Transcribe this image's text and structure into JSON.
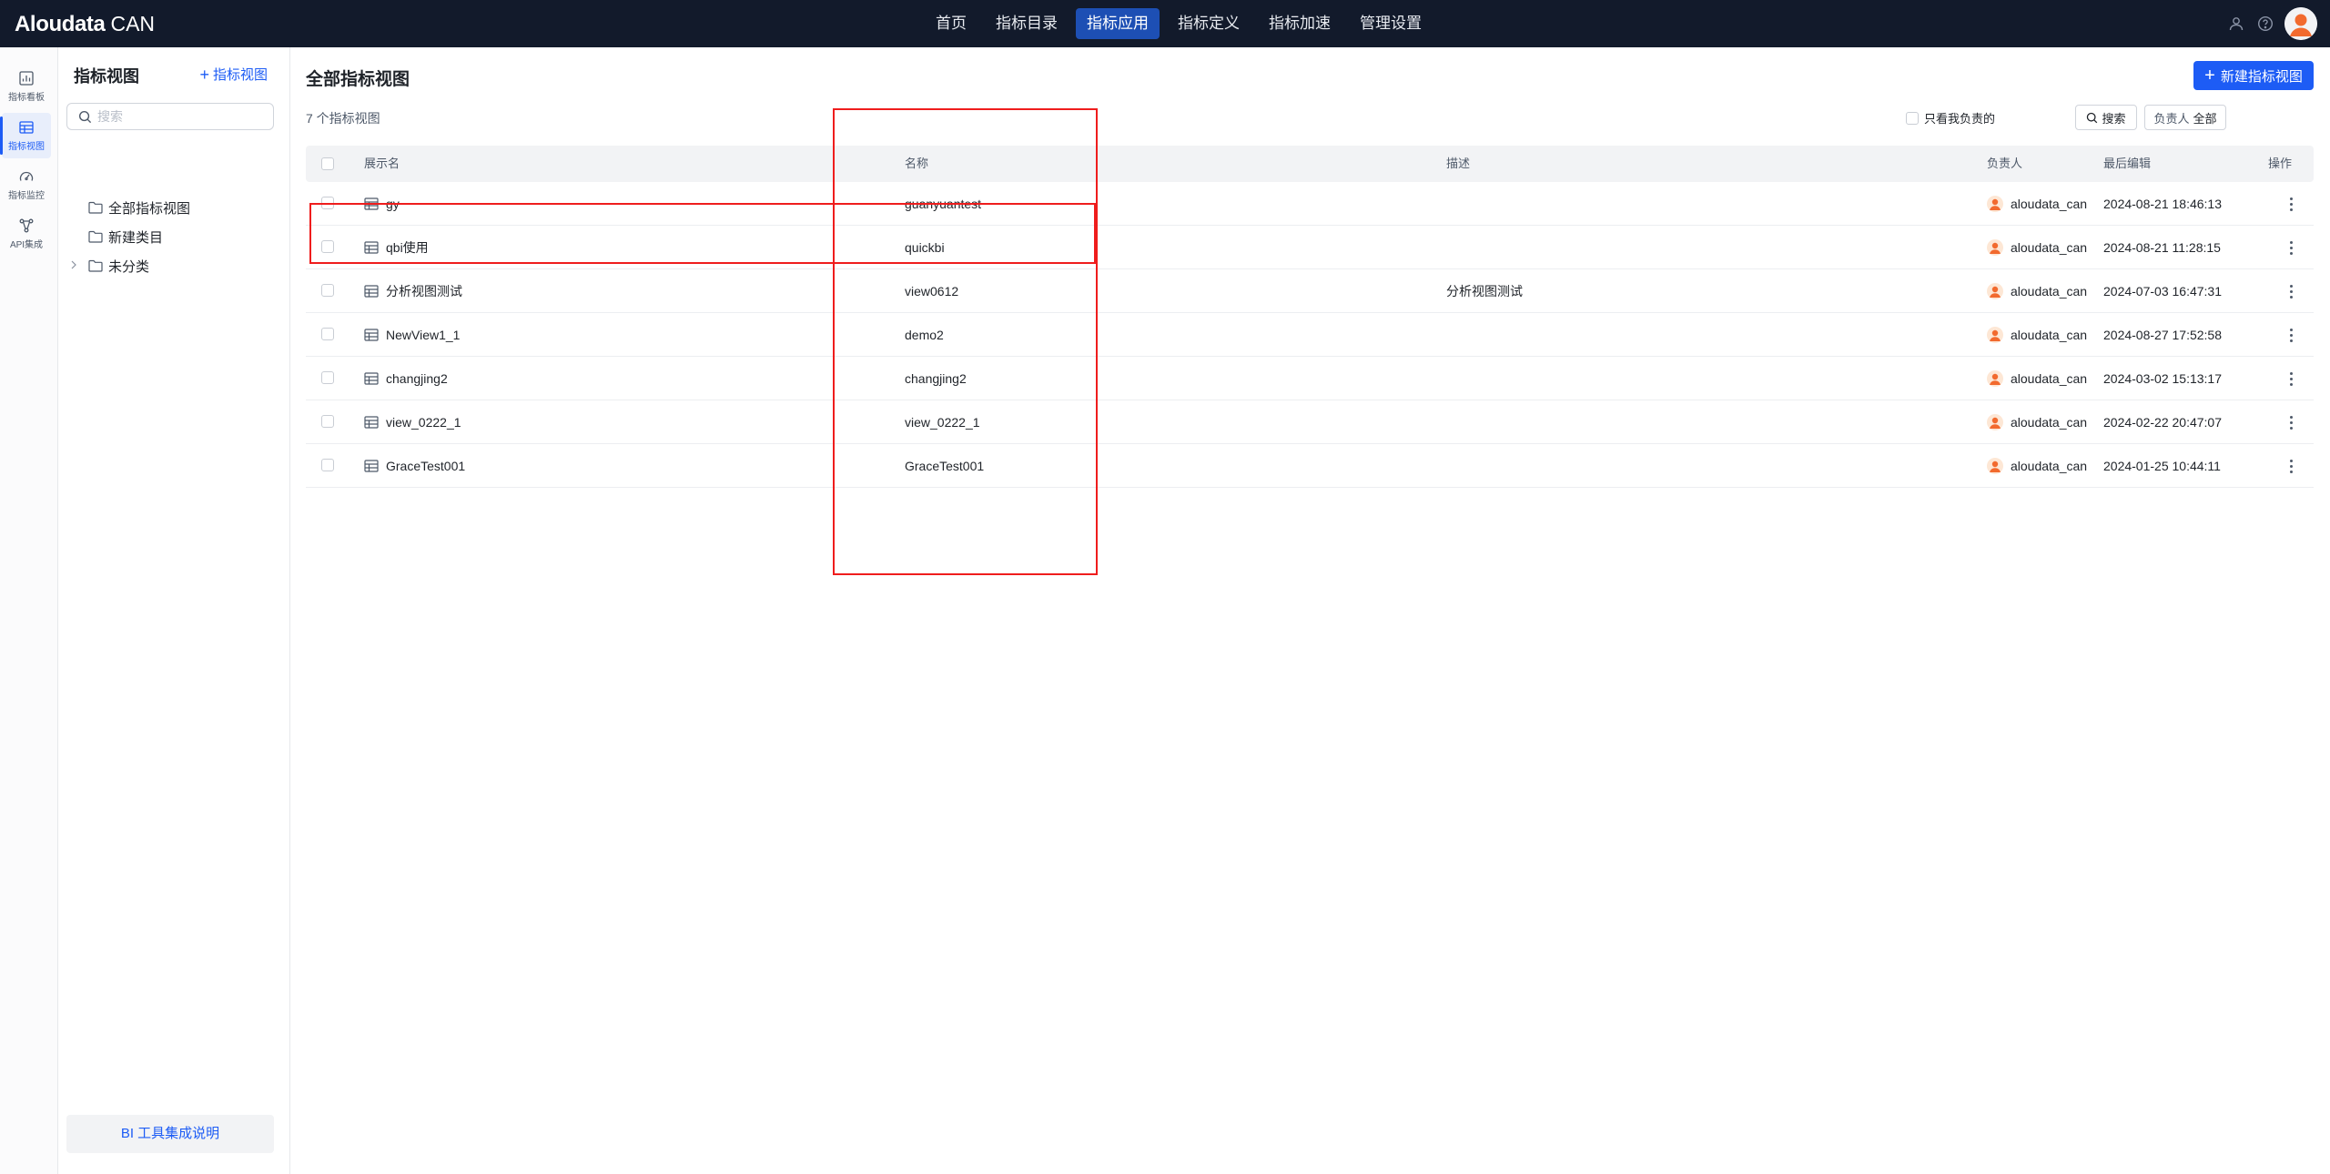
{
  "header": {
    "brand": "Aloudata",
    "brand_suffix": "CAN",
    "nav": [
      {
        "label": "首页",
        "active": false
      },
      {
        "label": "指标目录",
        "active": false
      },
      {
        "label": "指标应用",
        "active": true
      },
      {
        "label": "指标定义",
        "active": false
      },
      {
        "label": "指标加速",
        "active": false
      },
      {
        "label": "管理设置",
        "active": false
      }
    ],
    "icons": [
      "user-manage-icon",
      "help-icon",
      "user-avatar"
    ]
  },
  "rail": {
    "items": [
      {
        "label": "指标看板",
        "icon": "dashboard-icon",
        "active": false
      },
      {
        "label": "指标视图",
        "icon": "table-view-icon",
        "active": true
      },
      {
        "label": "指标监控",
        "icon": "gauge-icon",
        "active": false
      },
      {
        "label": "API集成",
        "icon": "api-icon",
        "active": false
      }
    ]
  },
  "sidebar": {
    "title": "指标视图",
    "add_label": "指标视图",
    "search_placeholder": "搜索",
    "tree": [
      {
        "label": "全部指标视图",
        "expandable": false
      },
      {
        "label": "新建类目",
        "expandable": false
      },
      {
        "label": "未分类",
        "expandable": true
      }
    ],
    "bi_help": "BI 工具集成说明"
  },
  "main": {
    "title": "全部指标视图",
    "new_button": "新建指标视图",
    "count_text": "7 个指标视图",
    "search_button": "搜索",
    "owner_filter_label": "负责人",
    "owner_filter_value": "全部",
    "only_mine_label": "只看我负责的",
    "columns": {
      "display_name": "展示名",
      "name": "名称",
      "description": "描述",
      "owner": "负责人",
      "last_edited": "最后编辑",
      "actions": "操作"
    },
    "rows": [
      {
        "display_name": "gy",
        "name": "guanyuantest",
        "description": "",
        "owner": "aloudata_can",
        "last_edited": "2024-08-21 18:46:13"
      },
      {
        "display_name": "qbi使用",
        "name": "quickbi",
        "description": "",
        "owner": "aloudata_can",
        "last_edited": "2024-08-21 11:28:15"
      },
      {
        "display_name": "分析视图测试",
        "name": "view0612",
        "description": "分析视图测试",
        "owner": "aloudata_can",
        "last_edited": "2024-07-03 16:47:31"
      },
      {
        "display_name": "NewView1_1",
        "name": "demo2",
        "description": "",
        "owner": "aloudata_can",
        "last_edited": "2024-08-27 17:52:58"
      },
      {
        "display_name": "changjing2",
        "name": "changjing2",
        "description": "",
        "owner": "aloudata_can",
        "last_edited": "2024-03-02 15:13:17"
      },
      {
        "display_name": "view_0222_1",
        "name": "view_0222_1",
        "description": "",
        "owner": "aloudata_can",
        "last_edited": "2024-02-22 20:47:07"
      },
      {
        "display_name": "GraceTest001",
        "name": "GraceTest001",
        "description": "",
        "owner": "aloudata_can",
        "last_edited": "2024-01-25 10:44:11"
      }
    ]
  },
  "colors": {
    "topbar_bg": "#121a2b",
    "nav_active_bg": "#1d4fb4",
    "primary": "#1d5cf5",
    "annotation_red": "#ef1d1d"
  }
}
